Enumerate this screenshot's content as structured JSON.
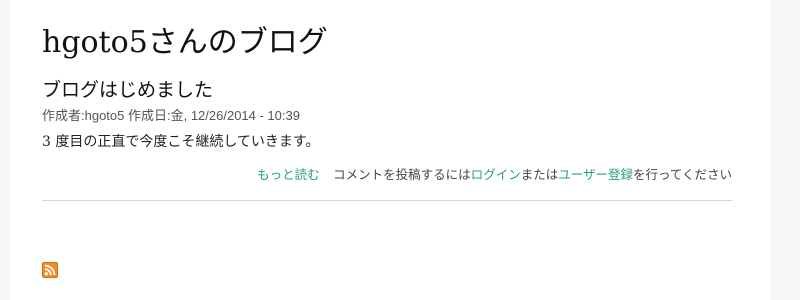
{
  "blog": {
    "title": "hgoto5さんのブログ"
  },
  "post": {
    "title": "ブログはじめました",
    "meta": "作成者:hgoto5 作成日:金, 12/26/2014 - 10:39",
    "body": "3 度目の正直で今度こそ継続していきます。",
    "links": {
      "read_more": "もっと読む",
      "comment_prefix": "コメントを投稿するには",
      "login": "ログイン",
      "or": "または",
      "register": "ユーザー登録",
      "comment_suffix": "を行ってください"
    }
  },
  "feed": {
    "icon": "rss-feed-icon",
    "color": "#f28c28"
  },
  "colors": {
    "link": "#27a26b",
    "text": "#111111",
    "meta": "#555555"
  }
}
